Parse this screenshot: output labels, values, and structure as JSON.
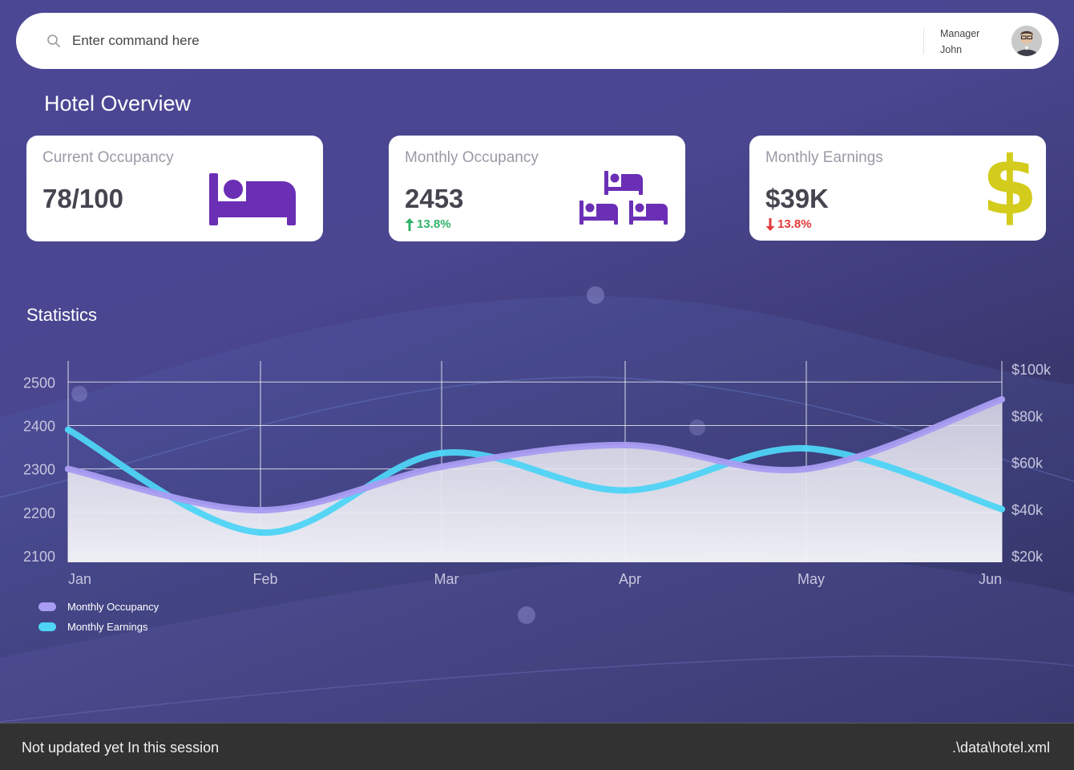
{
  "search": {
    "placeholder": "Enter command here"
  },
  "user": {
    "role": "Manager",
    "name": "John"
  },
  "page": {
    "title": "Hotel Overview"
  },
  "cards": [
    {
      "label": "Current Occupancy",
      "value": "78/100",
      "delta": "",
      "icon": "bed-icon"
    },
    {
      "label": "Monthly Occupancy",
      "value": "2453",
      "delta": "13.8%",
      "delta_direction": "up",
      "icon": "beds-icon"
    },
    {
      "label": "Monthly Earnings",
      "value": "$39K",
      "delta": "13.8%",
      "delta_direction": "down",
      "icon": "dollar-icon"
    }
  ],
  "colors": {
    "accent_purple": "#6a2fb5",
    "dollar_yellow": "#d3cc1c",
    "up_green": "#30b36a",
    "down_red": "#e33b3b",
    "occupancy_line": "#a99cf2",
    "earnings_line": "#4fd4f5"
  },
  "statistics": {
    "title": "Statistics"
  },
  "chart_data": {
    "type": "line",
    "categories": [
      "Jan",
      "Feb",
      "Mar",
      "Apr",
      "May",
      "Jun"
    ],
    "left_ticks": [
      "2100",
      "2200",
      "2300",
      "2400",
      "2500"
    ],
    "right_ticks": [
      "$20k",
      "$40k",
      "$60k",
      "$80k",
      "$100k"
    ],
    "ylim": [
      2100,
      2530
    ],
    "y2lim": [
      20000,
      100000
    ],
    "grid": true,
    "legend_position": "bottom-left",
    "series": [
      {
        "name": "Monthly Occupancy",
        "axis": "left",
        "values": [
          2300,
          2205,
          2305,
          2355,
          2300,
          2460
        ]
      },
      {
        "name": "Monthly Earnings",
        "axis": "right",
        "values": [
          74000,
          30000,
          64000,
          48000,
          66000,
          40000
        ]
      }
    ]
  },
  "status": {
    "left": "Not updated yet In this session",
    "right": ".\\data\\hotel.xml"
  }
}
